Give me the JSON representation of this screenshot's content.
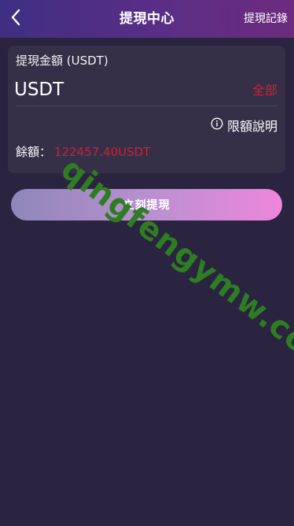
{
  "header": {
    "title": "提現中心",
    "record_link": "提現記錄",
    "back_icon": "chevron-left-icon"
  },
  "withdraw_card": {
    "amount_title": "提現金額 (USDT)",
    "amount_placeholder": "USDT",
    "all_button": "全部",
    "limit_link": "限額說明",
    "limit_icon": "info-circle-icon",
    "balance_label": "餘額：",
    "balance_value": "122457.40USDT"
  },
  "submit_button": "立刻提現",
  "watermark": "qingfengymw.com",
  "colors": {
    "background": "#2a2440",
    "card": "#353048",
    "accent_red": "#d0202f",
    "header_gradient_start": "#3e2f83",
    "header_gradient_end": "#6c2b7e",
    "button_gradient_start": "#8f86b8",
    "button_gradient_end": "#ef86dc",
    "watermark": "#2e7d22"
  }
}
